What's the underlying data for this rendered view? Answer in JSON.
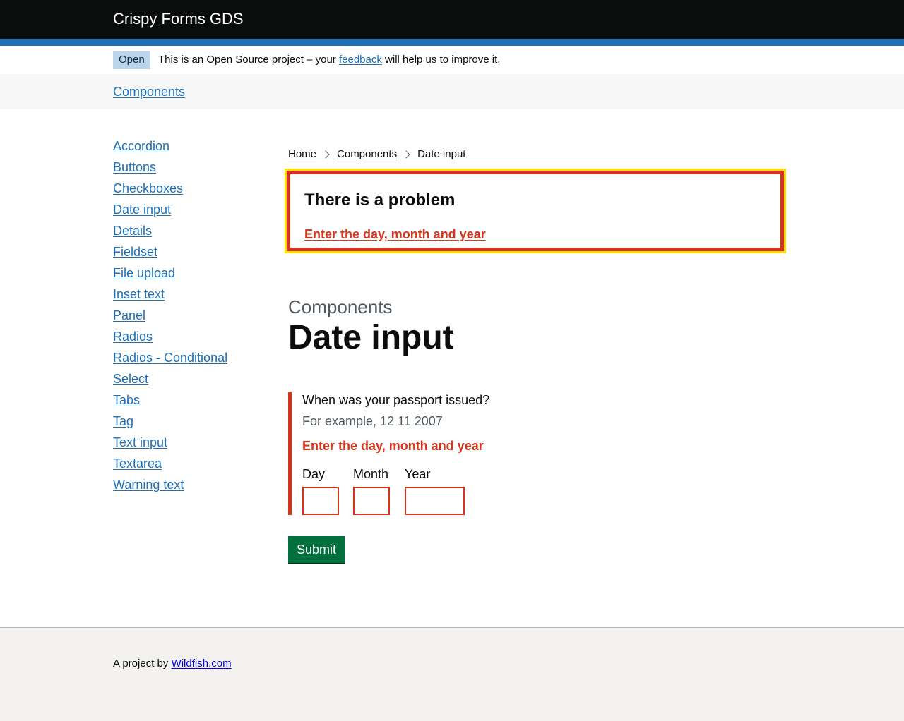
{
  "header": {
    "title": "Crispy Forms GDS"
  },
  "phase_banner": {
    "tag": "Open",
    "text_before": "This is an Open Source project – your",
    "link": "feedback",
    "text_after": "will help us to improve it."
  },
  "subnav": {
    "link": "Components"
  },
  "sidebar": {
    "items": [
      {
        "label": "Accordion"
      },
      {
        "label": "Buttons"
      },
      {
        "label": "Checkboxes"
      },
      {
        "label": "Date input"
      },
      {
        "label": "Details"
      },
      {
        "label": "Fieldset"
      },
      {
        "label": "File upload"
      },
      {
        "label": "Inset text"
      },
      {
        "label": "Panel"
      },
      {
        "label": "Radios"
      },
      {
        "label": "Radios - Conditional"
      },
      {
        "label": "Select"
      },
      {
        "label": "Tabs"
      },
      {
        "label": "Tag"
      },
      {
        "label": "Text input"
      },
      {
        "label": "Textarea"
      },
      {
        "label": "Warning text"
      }
    ]
  },
  "breadcrumbs": {
    "home": "Home",
    "components": "Components",
    "current": "Date input"
  },
  "error_summary": {
    "title": "There is a problem",
    "error_link": "Enter the day, month and year"
  },
  "page": {
    "caption": "Components",
    "title": "Date input"
  },
  "form": {
    "legend": "When was your passport issued?",
    "hint": "For example, 12 11 2007",
    "error_message": "Enter the day, month and year",
    "day_label": "Day",
    "month_label": "Month",
    "year_label": "Year",
    "day_value": "",
    "month_value": "",
    "year_value": "",
    "submit_label": "Submit"
  },
  "footer": {
    "text": "A project by",
    "link": "Wildfish.com"
  },
  "colors": {
    "brand_blue": "#1d70b8",
    "header_black": "#0b0c0c",
    "error_red": "#d4351c",
    "focus_yellow": "#ffdd00",
    "button_green": "#00703c",
    "tag_blue": "#bbd4ea"
  }
}
